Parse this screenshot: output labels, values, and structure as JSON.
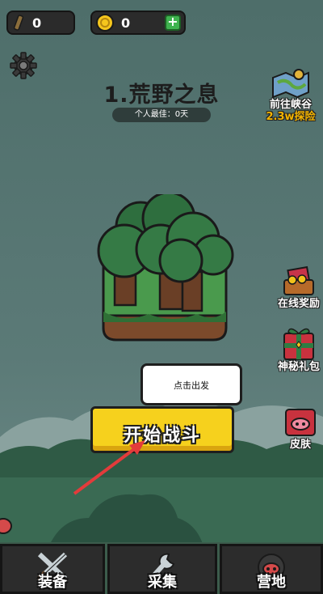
{
  "resources": {
    "scroll": {
      "icon": "scroll-icon",
      "value": "0"
    },
    "coins": {
      "icon": "coin-icon",
      "value": "0",
      "add_icon": "plus-icon",
      "add_label": "+"
    }
  },
  "settings_icon": "gear-icon",
  "stage": {
    "title": "1.荒野之息",
    "best_record": "个人最佳：0天"
  },
  "side_buttons": [
    {
      "id": "canyon",
      "label": "前往峡谷",
      "sublabel": "2.3w探险",
      "icon": "map-icon"
    },
    {
      "id": "online",
      "label": "在线奖励",
      "icon": "treasure-chest-icon"
    },
    {
      "id": "gift",
      "label": "神秘礼包",
      "icon": "gift-box-icon"
    },
    {
      "id": "skin",
      "label": "皮肤",
      "icon": "pig-skin-icon"
    }
  ],
  "hint_bubble": "点击出发",
  "start_button": "开始战斗",
  "tabs": [
    {
      "label": "装备",
      "icon": "crossed-swords-icon"
    },
    {
      "label": "采集",
      "icon": "wrench-icon"
    },
    {
      "label": "营地",
      "icon": "camp-icon"
    }
  ],
  "colors": {
    "background": "#4f6f6b",
    "start_button": "#f6d11d",
    "accent_gold": "#f2b300",
    "add_button": "#3fb34f"
  }
}
